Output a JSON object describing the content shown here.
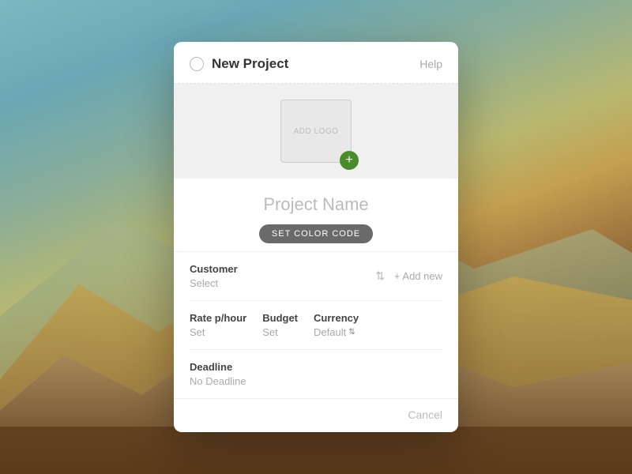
{
  "background": {
    "colors": [
      "#7bb8c0",
      "#8aad99",
      "#b8b870",
      "#a07840",
      "#6a4820"
    ]
  },
  "dialog": {
    "title": "New Project",
    "help_label": "Help",
    "circle_icon": "○",
    "logo": {
      "add_logo_text": "ADD LOGO",
      "add_badge": "+"
    },
    "project_name_placeholder": "Project Name",
    "color_code_btn": "SET COLOR CODE",
    "fields": {
      "customer": {
        "label": "Customer",
        "value": "Select",
        "add_new": "+ Add new"
      },
      "rate": {
        "label": "Rate p/hour",
        "value": "Set"
      },
      "budget": {
        "label": "Budget",
        "value": "Set"
      },
      "currency": {
        "label": "Currency",
        "value": "Default"
      },
      "deadline": {
        "label": "Deadline",
        "value": "No Deadline"
      }
    },
    "footer": {
      "cancel_label": "Cancel"
    }
  }
}
